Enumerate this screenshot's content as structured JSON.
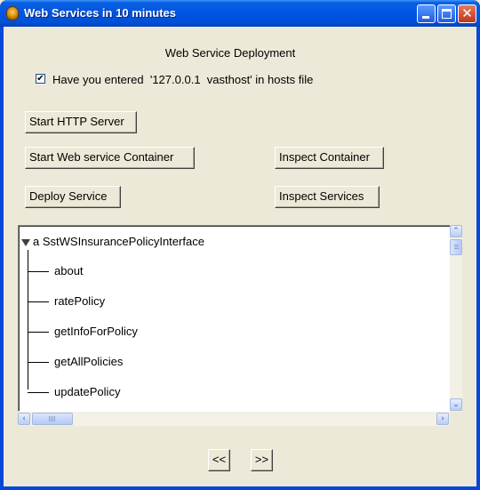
{
  "window": {
    "title": "Web Services in 10 minutes",
    "accent_color": "#0054e3",
    "icons": {
      "app": "app-icon",
      "minimize": "minimize-icon",
      "maximize": "maximize-icon",
      "close": "close-icon"
    }
  },
  "main": {
    "heading": "Web Service Deployment",
    "hosts_check": {
      "checked": true,
      "mark": "✔",
      "label": "Have you entered  '127.0.0.1  vasthost' in hosts file"
    },
    "buttons": {
      "start_http": "Start HTTP Server",
      "start_container": "Start Web service Container",
      "inspect_container": "Inspect Container",
      "deploy_service": "Deploy Service",
      "inspect_services": "Inspect Services"
    }
  },
  "tree": {
    "root_label": "a SstWSInsurancePolicyInterface",
    "expanded": true,
    "items": [
      {
        "label": "about"
      },
      {
        "label": "ratePolicy"
      },
      {
        "label": "getInfoForPolicy"
      },
      {
        "label": "getAllPolicies"
      },
      {
        "label": "updatePolicy"
      }
    ]
  },
  "scrollbars": {
    "up_glyph": "⌃",
    "down_glyph": "⌄",
    "left_glyph": "‹",
    "right_glyph": "›"
  },
  "nav": {
    "prev": "<<",
    "next": ">>"
  }
}
